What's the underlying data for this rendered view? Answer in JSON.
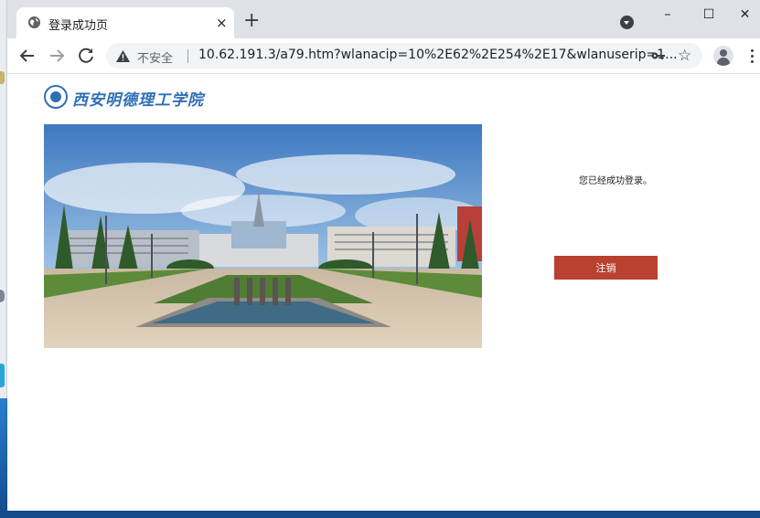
{
  "browser": {
    "tab_title": "登录成功页",
    "tab_close": "×",
    "new_tab": "+",
    "security_label": "不安全",
    "url": "10.62.191.3/a79.htm?wlanacip=10%2E62%2E254%2E17&wlanuserip=1...",
    "window_controls": {
      "minimize": "–",
      "maximize": "☐",
      "close": "✕"
    },
    "icons": [
      "globe-icon",
      "chevron-down-icon",
      "back-arrow-icon",
      "forward-arrow-icon",
      "reload-icon",
      "warning-icon",
      "key-icon",
      "star-icon",
      "profile-icon",
      "more-vert-icon"
    ]
  },
  "page": {
    "logo_text": "西安明德理工学院",
    "success_message": "您已经成功登录。",
    "logout_label": "注销"
  },
  "colors": {
    "logout_button": "#b9412f",
    "logo_blue": "#2f6fb6",
    "tabstrip": "#dee1e6"
  }
}
